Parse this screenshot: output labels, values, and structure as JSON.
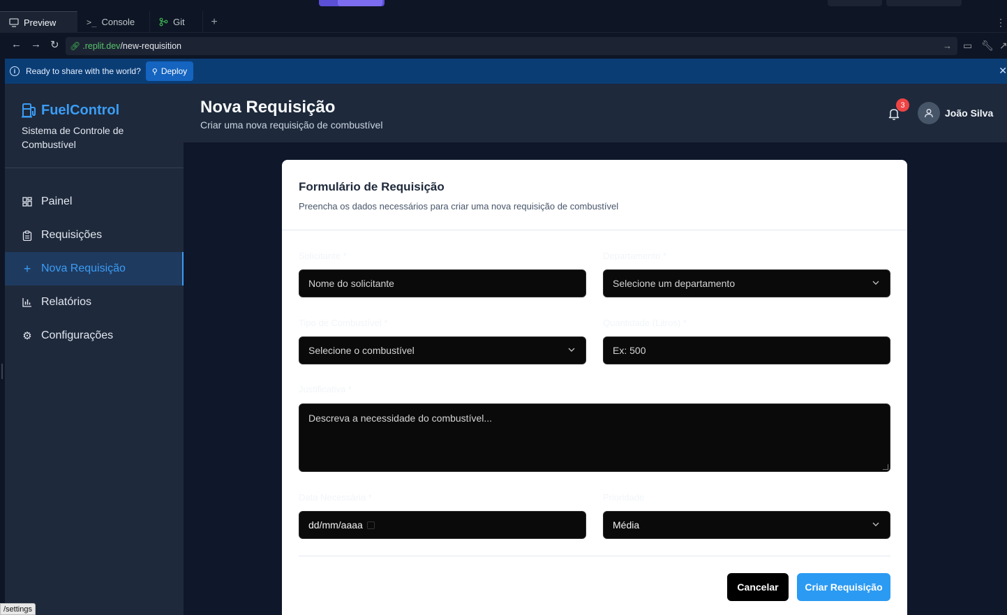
{
  "browser": {
    "tabs": [
      {
        "label": "Preview",
        "icon": "monitor-icon"
      },
      {
        "label": "Console",
        "icon": "terminal-icon"
      },
      {
        "label": "Git",
        "icon": "git-icon"
      }
    ],
    "url_host": ".replit.dev",
    "url_path": "/new-requisition",
    "deploy_message": "Ready to share with the world?",
    "deploy_label": "Deploy",
    "status_url": "/settings"
  },
  "sidebar": {
    "brand": "FuelControl",
    "subtitle": "Sistema de Controle de Combustível",
    "items": [
      {
        "label": "Painel",
        "icon": "grid-icon",
        "active": false
      },
      {
        "label": "Requisições",
        "icon": "clipboard-icon",
        "active": false
      },
      {
        "label": "Nova Requisição",
        "icon": "plus-icon",
        "active": true
      },
      {
        "label": "Relatórios",
        "icon": "bar-chart-icon",
        "active": false
      },
      {
        "label": "Configurações",
        "icon": "gear-icon",
        "active": false
      }
    ]
  },
  "header": {
    "title": "Nova Requisição",
    "subtitle": "Criar uma nova requisição de combustível",
    "notifications": "3",
    "user_name": "João Silva"
  },
  "form": {
    "title": "Formulário de Requisição",
    "description": "Preencha os dados necessários para criar uma nova requisição de combustível",
    "requester": {
      "label": "Solicitante *",
      "placeholder": "Nome do solicitante"
    },
    "department": {
      "label": "Departamento *",
      "placeholder": "Selecione um departamento"
    },
    "fuel_type": {
      "label": "Tipo de Combustível *",
      "placeholder": "Selecione o combustível"
    },
    "quantity": {
      "label": "Quantidade (Litros) *",
      "placeholder": "Ex: 500"
    },
    "justification": {
      "label": "Justificativa *",
      "placeholder": "Descreva a necessidade do combustível..."
    },
    "date_needed": {
      "label": "Data Necessária *",
      "placeholder": "dd/mm/aaaa"
    },
    "priority": {
      "label": "Prioridade",
      "value": "Média"
    },
    "cancel_label": "Cancelar",
    "submit_label": "Criar Requisição"
  },
  "colors": {
    "accent": "#3b9df5",
    "sidebar_bg": "#1e293b",
    "main_bg": "#0f172a",
    "badge": "#ef4444",
    "primary_button": "#2b9af3"
  }
}
